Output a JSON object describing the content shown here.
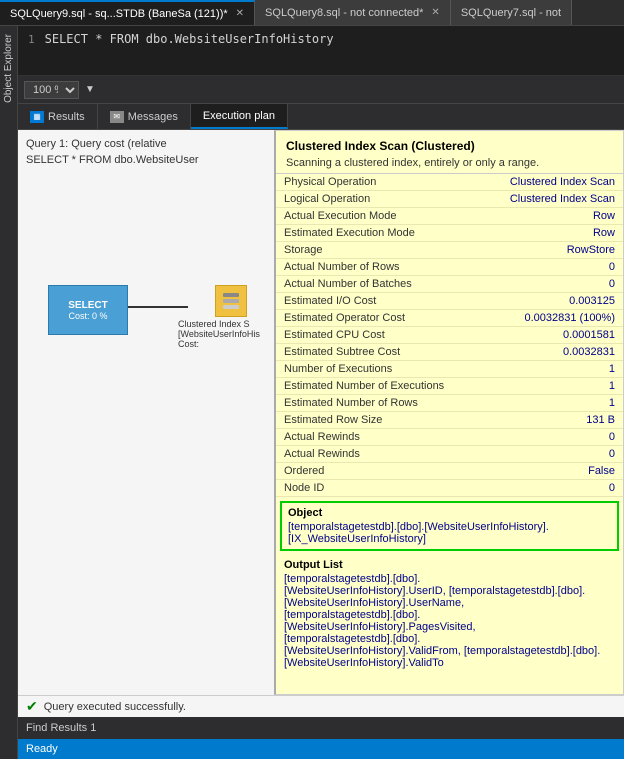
{
  "tabs": [
    {
      "id": "tab1",
      "label": "SQLQuery9.sql - sq...STDB (BaneSa (121))*",
      "active": true
    },
    {
      "id": "tab2",
      "label": "SQLQuery8.sql - not connected*",
      "active": false
    },
    {
      "id": "tab3",
      "label": "SQLQuery7.sql - not",
      "active": false
    }
  ],
  "code": {
    "line_num": "1",
    "content": "SELECT * FROM dbo.WebsiteUserInfoHistory"
  },
  "toolbar": {
    "zoom": "100 %"
  },
  "result_tabs": [
    {
      "label": "Results",
      "active": false
    },
    {
      "label": "Messages",
      "active": false
    },
    {
      "label": "Execution plan",
      "active": true
    }
  ],
  "plan": {
    "query_line1": "Query 1: Query cost (relative",
    "query_line2": "SELECT * FROM dbo.WebsiteUser",
    "select_label": "SELECT",
    "select_cost": "Cost: 0 %",
    "ci_label": "Clustered Index S",
    "ci_sub": "[WebsiteUserInfoHis",
    "ci_cost": "Cost:"
  },
  "tooltip": {
    "title": "Clustered Index Scan (Clustered)",
    "subtitle": "Scanning a clustered index, entirely or only a range.",
    "rows": [
      {
        "label": "Physical Operation",
        "value": "Clustered Index Scan"
      },
      {
        "label": "Logical Operation",
        "value": "Clustered Index Scan"
      },
      {
        "label": "Actual Execution Mode",
        "value": "Row"
      },
      {
        "label": "Estimated Execution Mode",
        "value": "Row"
      },
      {
        "label": "Storage",
        "value": "RowStore"
      },
      {
        "label": "Actual Number of Rows",
        "value": "0"
      },
      {
        "label": "Actual Number of Batches",
        "value": "0"
      },
      {
        "label": "Estimated I/O Cost",
        "value": "0.003125"
      },
      {
        "label": "Estimated Operator Cost",
        "value": "0.0032831 (100%)"
      },
      {
        "label": "Estimated CPU Cost",
        "value": "0.0001581"
      },
      {
        "label": "Estimated Subtree Cost",
        "value": "0.0032831"
      },
      {
        "label": "Number of Executions",
        "value": "1"
      },
      {
        "label": "Estimated Number of Executions",
        "value": "1"
      },
      {
        "label": "Estimated Number of Rows",
        "value": "1"
      },
      {
        "label": "Estimated Row Size",
        "value": "131 B"
      },
      {
        "label": "Actual Rewinds",
        "value": "0"
      },
      {
        "label": "Actual Rewinds",
        "value": "0"
      },
      {
        "label": "Ordered",
        "value": "False"
      },
      {
        "label": "Node ID",
        "value": "0"
      }
    ],
    "object_label": "Object",
    "object_value": "[temporalstagetestdb].[dbo].[WebsiteUserInfoHistory].\n[IX_WebsiteUserInfoHistory]",
    "output_label": "Output List",
    "output_value": "[temporalstagetestdb].[dbo].\n[WebsiteUserInfoHistory].UserID, [temporalstagetestdb].[dbo].\n[WebsiteUserInfoHistory].UserName,\n[temporalstagetestdb].[dbo].\n[WebsiteUserInfoHistory].PagesVisited,\n[temporalstagetestdb].[dbo].\n[WebsiteUserInfoHistory].ValidFrom, [temporalstagetestdb].[dbo].\n[WebsiteUserInfoHistory].ValidTo"
  },
  "status": {
    "success_text": "Query executed successfully.",
    "find_text": "Find Results 1",
    "ready_text": "Ready"
  },
  "sidebar_label": "Object Explorer"
}
